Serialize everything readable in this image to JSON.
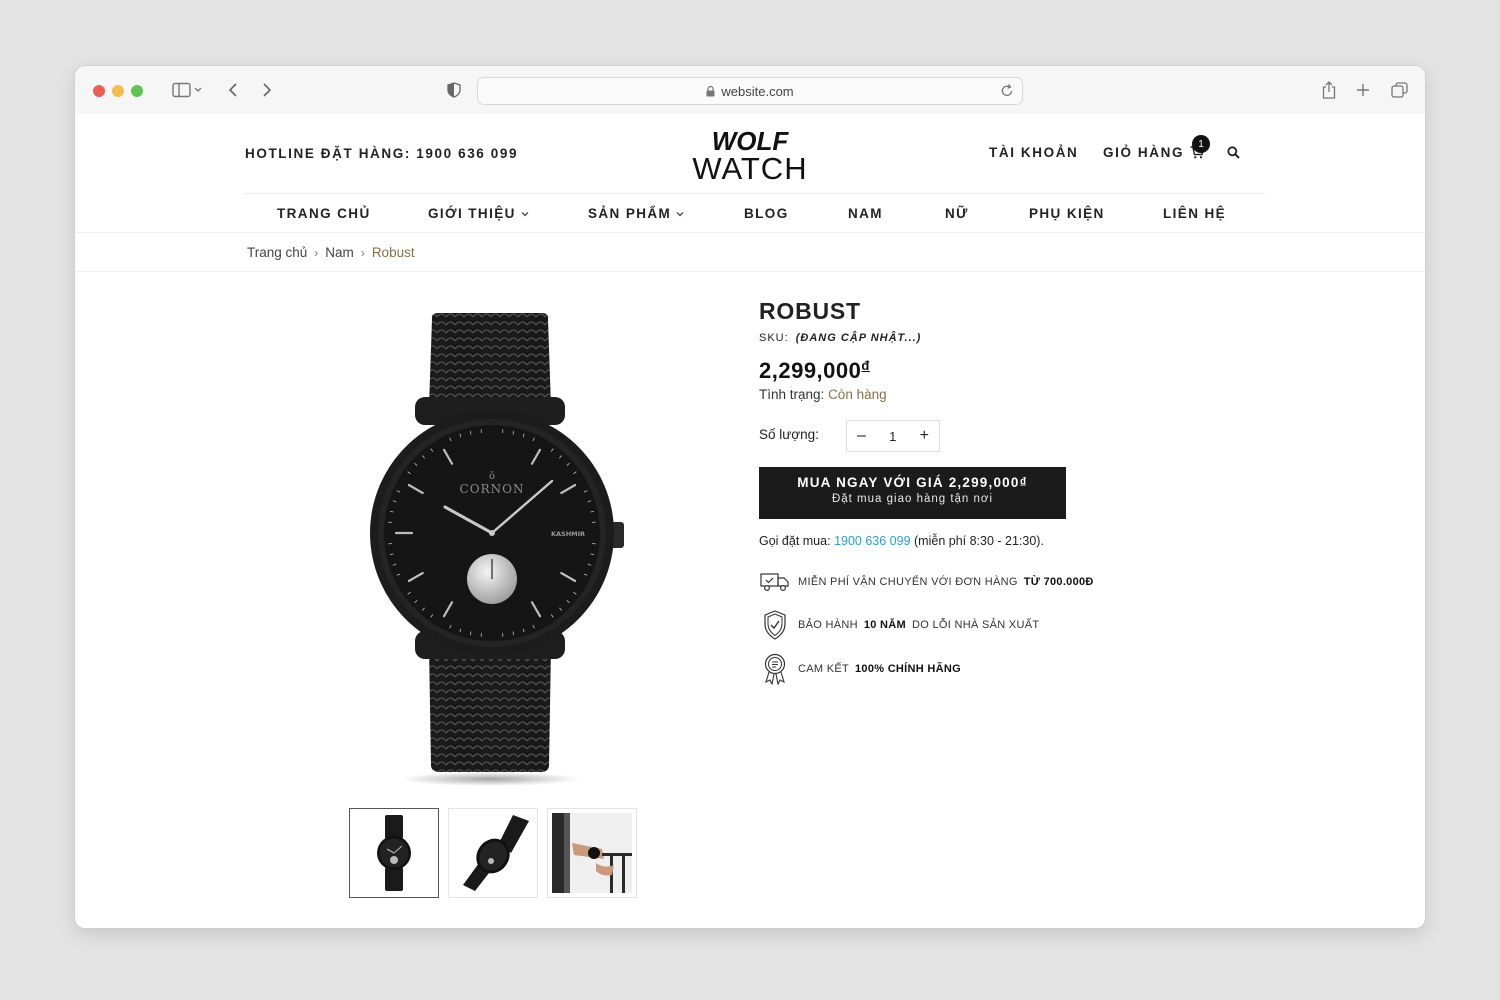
{
  "browser": {
    "url": "website.com"
  },
  "header": {
    "hotline_label": "HOTLINE ĐẶT HÀNG:",
    "hotline_number": "1900 636 099",
    "logo_line1": "WOLF",
    "logo_line2": "WATCH",
    "account": "TÀI KHOẢN",
    "cart": "GIỎ HÀNG",
    "cart_count": "1"
  },
  "nav": [
    {
      "label": "TRANG CHỦ",
      "dropdown": false
    },
    {
      "label": "GIỚI THIỆU",
      "dropdown": true
    },
    {
      "label": "SẢN PHẨM",
      "dropdown": true
    },
    {
      "label": "BLOG",
      "dropdown": false
    },
    {
      "label": "NAM",
      "dropdown": false
    },
    {
      "label": "NỮ",
      "dropdown": false
    },
    {
      "label": "PHỤ KIỆN",
      "dropdown": false
    },
    {
      "label": "LIÊN HỆ",
      "dropdown": false
    }
  ],
  "breadcrumb": [
    "Trang chủ",
    "Nam",
    "Robust"
  ],
  "product": {
    "watch_brand": "CORNON",
    "watch_model": "KASHMIR",
    "title": "ROBUST",
    "sku_label": "SKU:",
    "sku_value": "(ĐANG CẬP NHẬT...)",
    "price": "2,299,000",
    "currency": "đ",
    "stock_label": "Tình trạng:",
    "stock_value": "Còn hàng",
    "qty_label": "Số lượng:",
    "qty_minus": "–",
    "qty_value": "1",
    "qty_plus": "+",
    "buy_line1": "MUA NGAY VỚI GIÁ 2,299,000₫",
    "buy_line2": "Đặt mua giao hàng tận nơi",
    "call_label": "Gọi đặt mua:",
    "call_phone": "1900 636 099",
    "call_note": "(miễn phí 8:30 - 21:30)."
  },
  "features": [
    {
      "icon": "delivery-truck-icon",
      "before": "MIỄN PHÍ VẬN CHUYỂN VỚI ĐƠN HÀNG",
      "bold": "TỪ 700.000Đ",
      "after": ""
    },
    {
      "icon": "warranty-shield-icon",
      "before": "BẢO HÀNH",
      "bold": "10 NĂM",
      "after": "DO LỖI NHÀ SẢN XUẤT"
    },
    {
      "icon": "certificate-badge-icon",
      "before": "CAM KẾT",
      "bold": "100% CHÍNH HÃNG",
      "after": ""
    }
  ]
}
